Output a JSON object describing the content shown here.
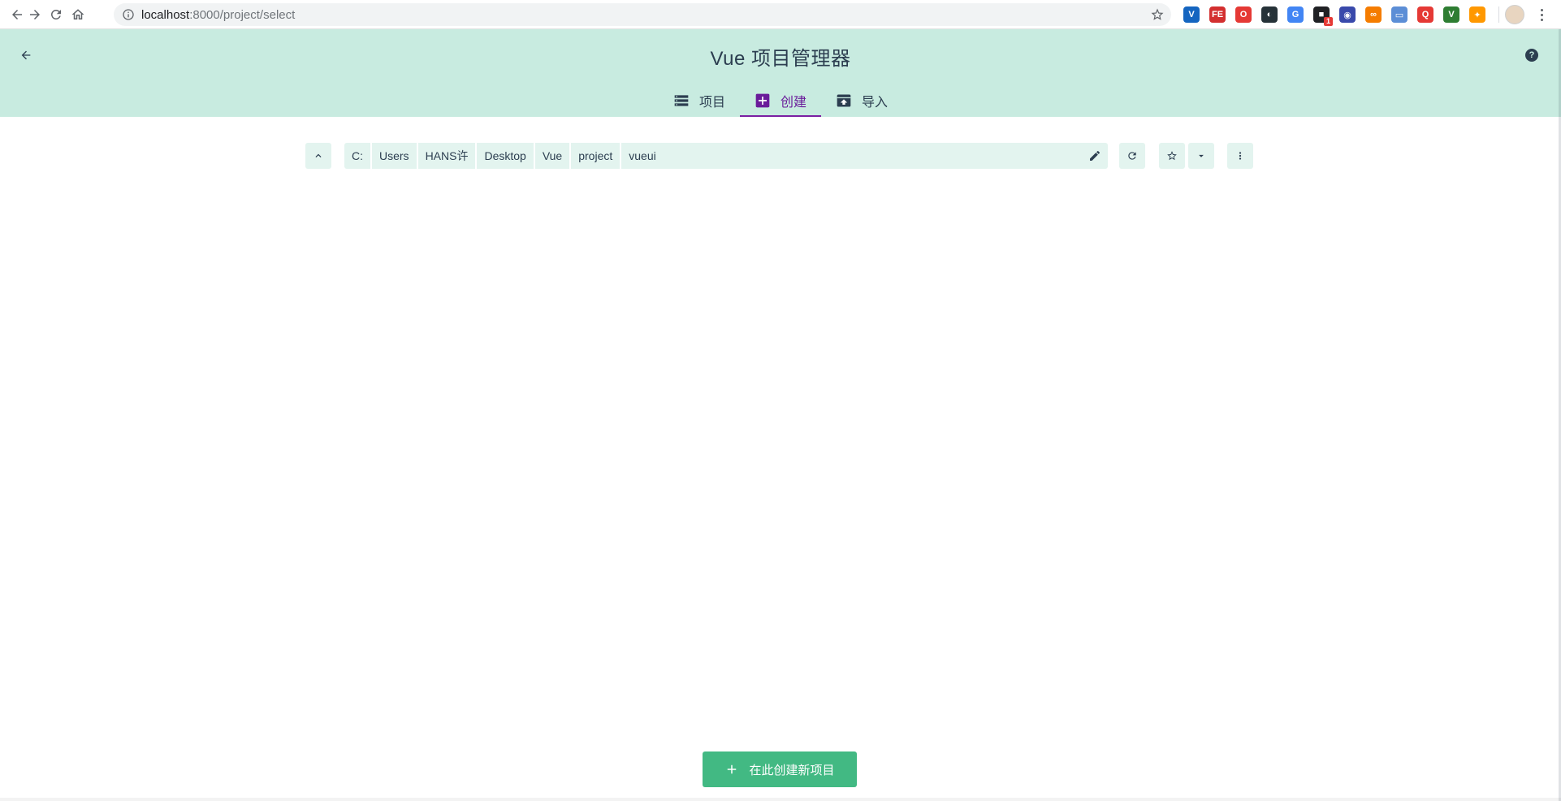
{
  "browser": {
    "url_host": "localhost",
    "url_rest": ":8000/project/select",
    "extensions": [
      {
        "icon": "vuejs-devtools-icon",
        "color": "#1565c0",
        "glyph": "V",
        "badge": ""
      },
      {
        "icon": "fe-helper-icon",
        "color": "#d32f2f",
        "glyph": "FE",
        "badge": ""
      },
      {
        "icon": "opera-icon",
        "color": "#e53935",
        "glyph": "O",
        "badge": ""
      },
      {
        "icon": "dark-gauge-icon",
        "color": "#263238",
        "glyph": "◐",
        "badge": ""
      },
      {
        "icon": "translate-icon",
        "color": "#4285f4",
        "glyph": "G",
        "badge": ""
      },
      {
        "icon": "notification-extension-icon",
        "color": "#202124",
        "glyph": "■",
        "badge": "1"
      },
      {
        "icon": "globe-extension-icon",
        "color": "#3949ab",
        "glyph": "◉",
        "badge": ""
      },
      {
        "icon": "infinity-extension-icon",
        "color": "#f57c00",
        "glyph": "∞",
        "badge": ""
      },
      {
        "icon": "window-extension-icon",
        "color": "#5c8ed6",
        "glyph": "▭",
        "badge": ""
      },
      {
        "icon": "search-extension-icon",
        "color": "#e53935",
        "glyph": "Q",
        "badge": ""
      },
      {
        "icon": "vue-extension-icon",
        "color": "#2e7d32",
        "glyph": "V",
        "badge": ""
      },
      {
        "icon": "colorful-extension-icon",
        "color": "#ff9800",
        "glyph": "✦",
        "badge": ""
      }
    ]
  },
  "header": {
    "title": "Vue 项目管理器",
    "tabs": [
      {
        "label": "项目",
        "icon": "list-icon",
        "active": false
      },
      {
        "label": "创建",
        "icon": "add-box-icon",
        "active": true
      },
      {
        "label": "导入",
        "icon": "unarchive-icon",
        "active": false
      }
    ],
    "help_glyph": "?"
  },
  "explorer": {
    "path_segments": [
      "C:",
      "Users",
      "HANS许",
      "Desktop",
      "Vue",
      "project",
      "vueui"
    ]
  },
  "actions": {
    "create_here_label": "在此创建新项目"
  },
  "colors": {
    "header_bg": "#c8ebe0",
    "toolbar_bg": "#e3f4ef",
    "accent_green": "#42b983",
    "active_tab": "#6a1b9a",
    "text": "#2c3e50"
  }
}
